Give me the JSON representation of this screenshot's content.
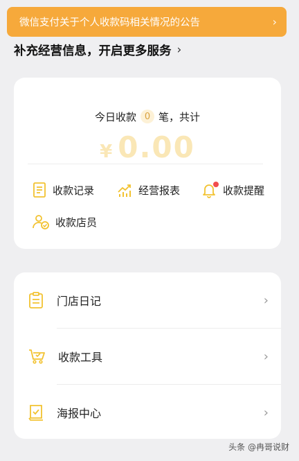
{
  "notice": {
    "text": "微信支付关于个人收款码相关情况的公告",
    "chevron": "›"
  },
  "info_link": {
    "text": "补充经营信息，开启更多服务",
    "chevron": "›"
  },
  "summary": {
    "prefix": "今日收款",
    "count": "0",
    "suffix": "笔，共计",
    "currency": "¥",
    "amount": "0.00"
  },
  "actions": [
    {
      "label": "收款记录",
      "icon": "receipt-list-icon"
    },
    {
      "label": "经营报表",
      "icon": "chart-trend-icon"
    },
    {
      "label": "收款提醒",
      "icon": "bell-icon"
    },
    {
      "label": "收款店员",
      "icon": "staff-check-icon"
    }
  ],
  "menu": [
    {
      "label": "门店日记",
      "icon": "clipboard-icon"
    },
    {
      "label": "收款工具",
      "icon": "cart-icon"
    },
    {
      "label": "海报中心",
      "icon": "poster-icon"
    }
  ],
  "watermark": "头条 @冉哥说财",
  "colors": {
    "accent": "#f6a93b",
    "icon": "#f2c230",
    "amount": "#fae7b6",
    "dot": "#f24d4d"
  }
}
